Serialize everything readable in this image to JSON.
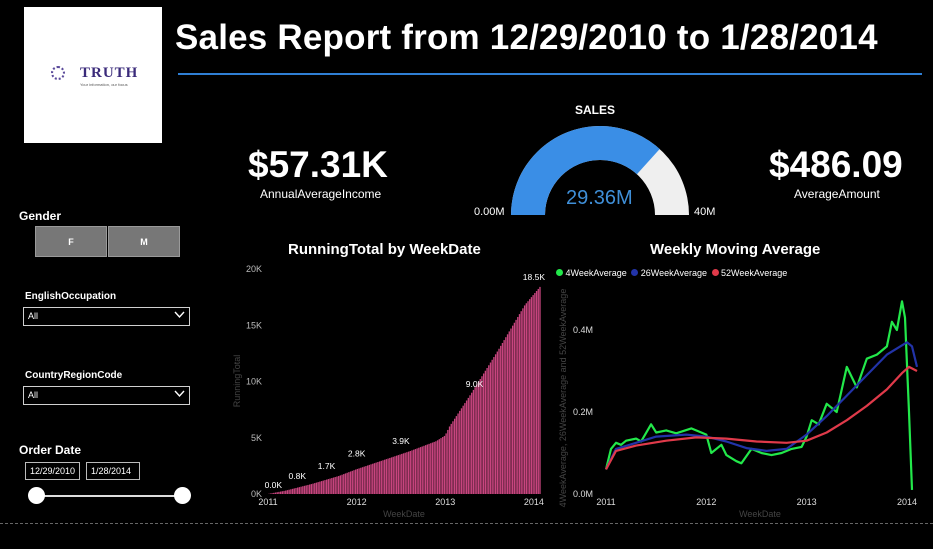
{
  "logo": {
    "brand": "TRUTH",
    "tagline": "Your information, our focus"
  },
  "header": {
    "title": "Sales Report from 12/29/2010 to 1/28/2014"
  },
  "kpis": {
    "annual_avg_income": {
      "value": "$57.31K",
      "label": "AnnualAverageIncome"
    },
    "average_amount": {
      "value": "$486.09",
      "label": "AverageAmount"
    }
  },
  "gauge": {
    "title": "SALES",
    "value": "29.36M",
    "min": "0.00M",
    "max": "40M",
    "fraction": 0.734
  },
  "filters": {
    "gender": {
      "label": "Gender",
      "options": [
        "F",
        "M"
      ]
    },
    "occupation": {
      "label": "EnglishOccupation",
      "selected": "All"
    },
    "country": {
      "label": "CountryRegionCode",
      "selected": "All"
    },
    "order_date": {
      "label": "Order Date",
      "start": "12/29/2010",
      "end": "1/28/2014",
      "range": [
        0,
        1
      ]
    }
  },
  "colors": {
    "accent": "#2f7fd4",
    "gauge_fill": "#3a8ee6",
    "gauge_empty": "#efefef",
    "bars": "#c8457f",
    "s4": "#22e84a",
    "s26": "#2233a8",
    "s52": "#e03a4a"
  },
  "chart_data": [
    {
      "type": "bar",
      "title": "RunningTotal by WeekDate",
      "xlabel": "WeekDate",
      "ylabel": "RunningTotal",
      "xlim": [
        2011,
        2014.08
      ],
      "ylim": [
        0,
        20000
      ],
      "yticks": [
        {
          "v": 0,
          "t": "0K"
        },
        {
          "v": 5000,
          "t": "5K"
        },
        {
          "v": 10000,
          "t": "10K"
        },
        {
          "v": 15000,
          "t": "15K"
        },
        {
          "v": 20000,
          "t": "20K"
        }
      ],
      "xticks": [
        {
          "v": 2011,
          "t": "2011"
        },
        {
          "v": 2012,
          "t": "2012"
        },
        {
          "v": 2013,
          "t": "2013"
        },
        {
          "v": 2014,
          "t": "2014"
        }
      ],
      "profile": [
        [
          2011.0,
          0
        ],
        [
          2011.2,
          300
        ],
        [
          2011.5,
          900
        ],
        [
          2011.8,
          1600
        ],
        [
          2012.0,
          2200
        ],
        [
          2012.3,
          3000
        ],
        [
          2012.6,
          3800
        ],
        [
          2012.9,
          4700
        ],
        [
          2013.0,
          5200
        ],
        [
          2013.05,
          6000
        ],
        [
          2013.3,
          9000
        ],
        [
          2013.6,
          12800
        ],
        [
          2013.9,
          16800
        ],
        [
          2014.08,
          18500
        ]
      ],
      "labels": [
        {
          "x": 2011.06,
          "y": 0,
          "t": "0.0K"
        },
        {
          "x": 2011.33,
          "y": 800,
          "t": "0.8K"
        },
        {
          "x": 2011.66,
          "y": 1700,
          "t": "1.7K"
        },
        {
          "x": 2012.0,
          "y": 2800,
          "t": "2.8K"
        },
        {
          "x": 2012.5,
          "y": 3900,
          "t": "3.9K"
        },
        {
          "x": 2013.33,
          "y": 9000,
          "t": "9.0K"
        },
        {
          "x": 2014.0,
          "y": 18500,
          "t": "18.5K"
        }
      ]
    },
    {
      "type": "line",
      "title": "Weekly Moving Average",
      "xlabel": "WeekDate",
      "ylabel": "4WeekAverage, 26WeekAverage and 52WeekAverage",
      "xlim": [
        2011,
        2014.1
      ],
      "ylim": [
        0,
        400000
      ],
      "yticks": [
        {
          "v": 0,
          "t": "0.0M"
        },
        {
          "v": 200000,
          "t": "0.2M"
        },
        {
          "v": 400000,
          "t": "0.4M"
        }
      ],
      "xticks": [
        {
          "v": 2011,
          "t": "2011"
        },
        {
          "v": 2012,
          "t": "2012"
        },
        {
          "v": 2013,
          "t": "2013"
        },
        {
          "v": 2014,
          "t": "2014"
        }
      ],
      "series": [
        {
          "name": "4WeekAverage",
          "color": "#22e84a",
          "points": [
            [
              2011.0,
              60000
            ],
            [
              2011.05,
              110000
            ],
            [
              2011.1,
              125000
            ],
            [
              2011.15,
              120000
            ],
            [
              2011.2,
              130000
            ],
            [
              2011.3,
              135000
            ],
            [
              2011.35,
              128000
            ],
            [
              2011.45,
              170000
            ],
            [
              2011.5,
              150000
            ],
            [
              2011.6,
              155000
            ],
            [
              2011.7,
              148000
            ],
            [
              2011.85,
              160000
            ],
            [
              2011.95,
              150000
            ],
            [
              2012.0,
              145000
            ],
            [
              2012.05,
              100000
            ],
            [
              2012.15,
              120000
            ],
            [
              2012.2,
              95000
            ],
            [
              2012.3,
              80000
            ],
            [
              2012.35,
              75000
            ],
            [
              2012.45,
              110000
            ],
            [
              2012.55,
              100000
            ],
            [
              2012.65,
              95000
            ],
            [
              2012.75,
              100000
            ],
            [
              2012.85,
              110000
            ],
            [
              2012.95,
              115000
            ],
            [
              2013.0,
              140000
            ],
            [
              2013.05,
              180000
            ],
            [
              2013.12,
              170000
            ],
            [
              2013.2,
              220000
            ],
            [
              2013.3,
              200000
            ],
            [
              2013.4,
              310000
            ],
            [
              2013.5,
              260000
            ],
            [
              2013.6,
              330000
            ],
            [
              2013.7,
              340000
            ],
            [
              2013.8,
              360000
            ],
            [
              2013.85,
              420000
            ],
            [
              2013.9,
              400000
            ],
            [
              2013.95,
              470000
            ],
            [
              2013.98,
              430000
            ],
            [
              2014.02,
              200000
            ],
            [
              2014.05,
              10000
            ]
          ]
        },
        {
          "name": "26WeekAverage",
          "color": "#2233a8",
          "points": [
            [
              2011.0,
              60000
            ],
            [
              2011.1,
              110000
            ],
            [
              2011.3,
              125000
            ],
            [
              2011.5,
              140000
            ],
            [
              2011.8,
              145000
            ],
            [
              2012.0,
              140000
            ],
            [
              2012.2,
              128000
            ],
            [
              2012.4,
              112000
            ],
            [
              2012.6,
              105000
            ],
            [
              2012.8,
              110000
            ],
            [
              2013.0,
              145000
            ],
            [
              2013.2,
              190000
            ],
            [
              2013.4,
              240000
            ],
            [
              2013.6,
              290000
            ],
            [
              2013.8,
              340000
            ],
            [
              2014.0,
              370000
            ],
            [
              2014.05,
              360000
            ],
            [
              2014.1,
              310000
            ]
          ]
        },
        {
          "name": "52WeekAverage",
          "color": "#e03a4a",
          "points": [
            [
              2011.0,
              60000
            ],
            [
              2011.1,
              105000
            ],
            [
              2011.3,
              118000
            ],
            [
              2011.6,
              130000
            ],
            [
              2011.9,
              138000
            ],
            [
              2012.2,
              135000
            ],
            [
              2012.5,
              128000
            ],
            [
              2012.8,
              125000
            ],
            [
              2013.0,
              130000
            ],
            [
              2013.2,
              150000
            ],
            [
              2013.4,
              180000
            ],
            [
              2013.6,
              215000
            ],
            [
              2013.8,
              255000
            ],
            [
              2013.95,
              295000
            ],
            [
              2014.02,
              310000
            ],
            [
              2014.1,
              300000
            ]
          ]
        }
      ]
    }
  ]
}
